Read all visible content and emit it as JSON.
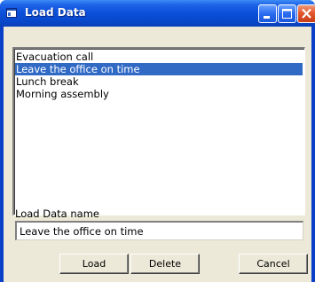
{
  "window": {
    "title": "Load Data"
  },
  "list": {
    "items": [
      "Evacuation call",
      "Leave the office on time",
      "Lunch break",
      "Morning assembly"
    ],
    "selected_index": 1
  },
  "name_field": {
    "label": "Load Data name",
    "value": "Leave the office on time"
  },
  "buttons": {
    "load": "Load",
    "delete": "Delete",
    "cancel": "Cancel"
  },
  "colors": {
    "titlebar": "#0a4fd8",
    "selection": "#316ac5",
    "dialog_face": "#ece9d8",
    "close_button": "#e4582e"
  }
}
